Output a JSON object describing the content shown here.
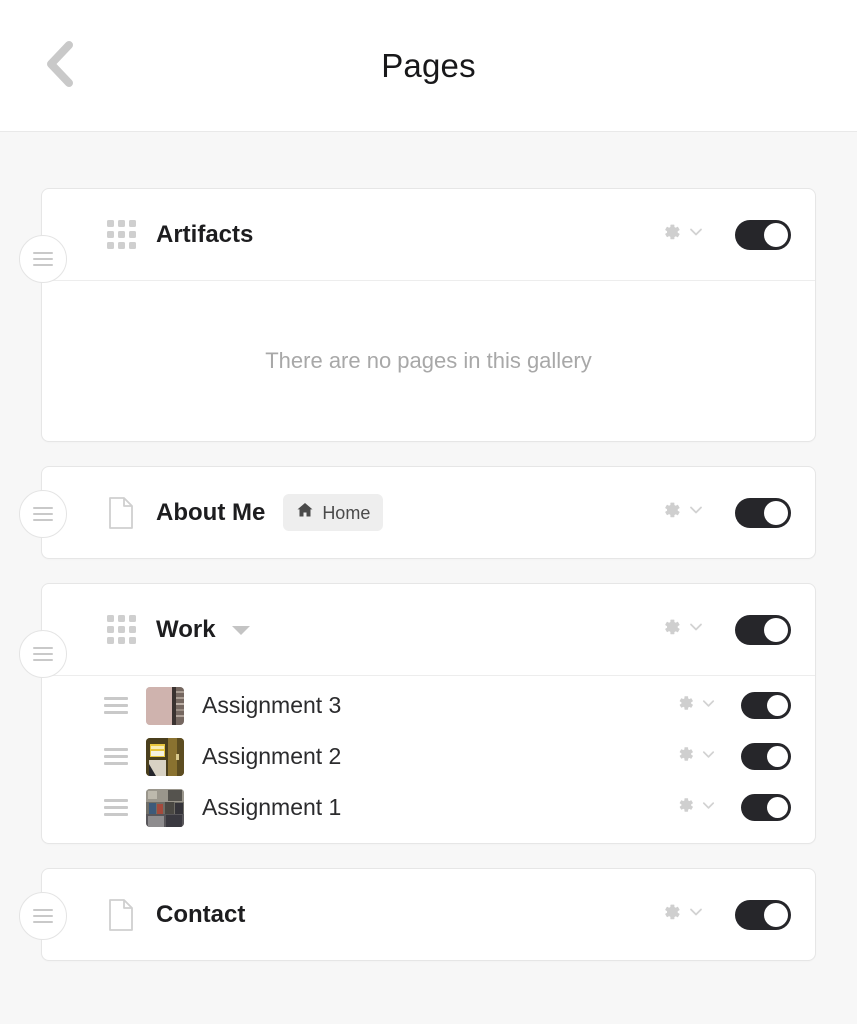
{
  "header": {
    "title": "Pages",
    "back_icon": "chevron-left-icon"
  },
  "items": [
    {
      "id": "artifacts",
      "title": "Artifacts",
      "type": "gallery",
      "type_icon": "grid-icon",
      "enabled": true,
      "gear_icon": "gear-icon",
      "chevron_icon": "chevron-down-icon",
      "handle_icon": "drag-handle-icon",
      "expanded": true,
      "empty_message": "There are no pages in this gallery",
      "children": []
    },
    {
      "id": "about-me",
      "title": "About Me",
      "type": "page",
      "type_icon": "document-icon",
      "enabled": true,
      "gear_icon": "gear-icon",
      "chevron_icon": "chevron-down-icon",
      "handle_icon": "drag-handle-icon",
      "badge": {
        "label": "Home",
        "icon": "home-icon"
      }
    },
    {
      "id": "work",
      "title": "Work",
      "type": "gallery",
      "type_icon": "grid-icon",
      "enabled": true,
      "gear_icon": "gear-icon",
      "chevron_icon": "chevron-down-icon",
      "handle_icon": "drag-handle-icon",
      "caret_icon": "caret-down-icon",
      "expanded": true,
      "children": [
        {
          "id": "assignment-3",
          "title": "Assignment 3",
          "enabled": true,
          "thumbnail": "assignment-3-thumbnail",
          "gear_icon": "gear-icon",
          "chevron_icon": "chevron-down-icon",
          "handle_icon": "drag-handle-icon"
        },
        {
          "id": "assignment-2",
          "title": "Assignment 2",
          "enabled": true,
          "thumbnail": "assignment-2-thumbnail",
          "gear_icon": "gear-icon",
          "chevron_icon": "chevron-down-icon",
          "handle_icon": "drag-handle-icon"
        },
        {
          "id": "assignment-1",
          "title": "Assignment 1",
          "enabled": true,
          "thumbnail": "assignment-1-thumbnail",
          "gear_icon": "gear-icon",
          "chevron_icon": "chevron-down-icon",
          "handle_icon": "drag-handle-icon"
        }
      ]
    },
    {
      "id": "contact",
      "title": "Contact",
      "type": "page",
      "type_icon": "document-icon",
      "enabled": true,
      "gear_icon": "gear-icon",
      "chevron_icon": "chevron-down-icon",
      "handle_icon": "drag-handle-icon"
    }
  ],
  "colors": {
    "background": "#f7f7f7",
    "card": "#ffffff",
    "border": "#e6e6e6",
    "toggle_on": "#26262a",
    "toggle_knob": "#ffffff",
    "icon_gray": "#cfcfcf",
    "title_text": "#1d1d1f",
    "muted_text": "#a8a8a8",
    "badge_background": "#eeeeee"
  }
}
